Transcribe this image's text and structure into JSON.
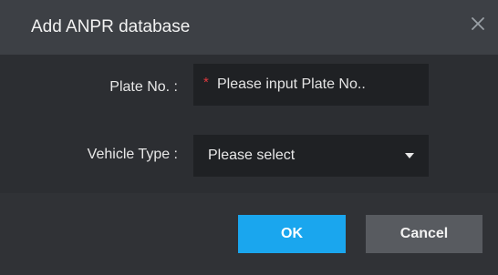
{
  "dialog": {
    "title": "Add ANPR database",
    "close_icon": "close-icon"
  },
  "form": {
    "plate": {
      "label": "Plate No. :",
      "required_marker": "*",
      "placeholder": "Please input Plate No..",
      "value": ""
    },
    "vehicle_type": {
      "label": "Vehicle Type :",
      "selected": "Please select",
      "caret_icon": "caret-down-icon"
    }
  },
  "footer": {
    "ok_label": "OK",
    "cancel_label": "Cancel"
  },
  "colors": {
    "accent": "#1aa6ee",
    "required": "#e0393e",
    "title_bar": "#3d4045",
    "body_bg": "#2c2e32",
    "input_bg": "#1f2124",
    "cancel_bg": "#585b60"
  }
}
